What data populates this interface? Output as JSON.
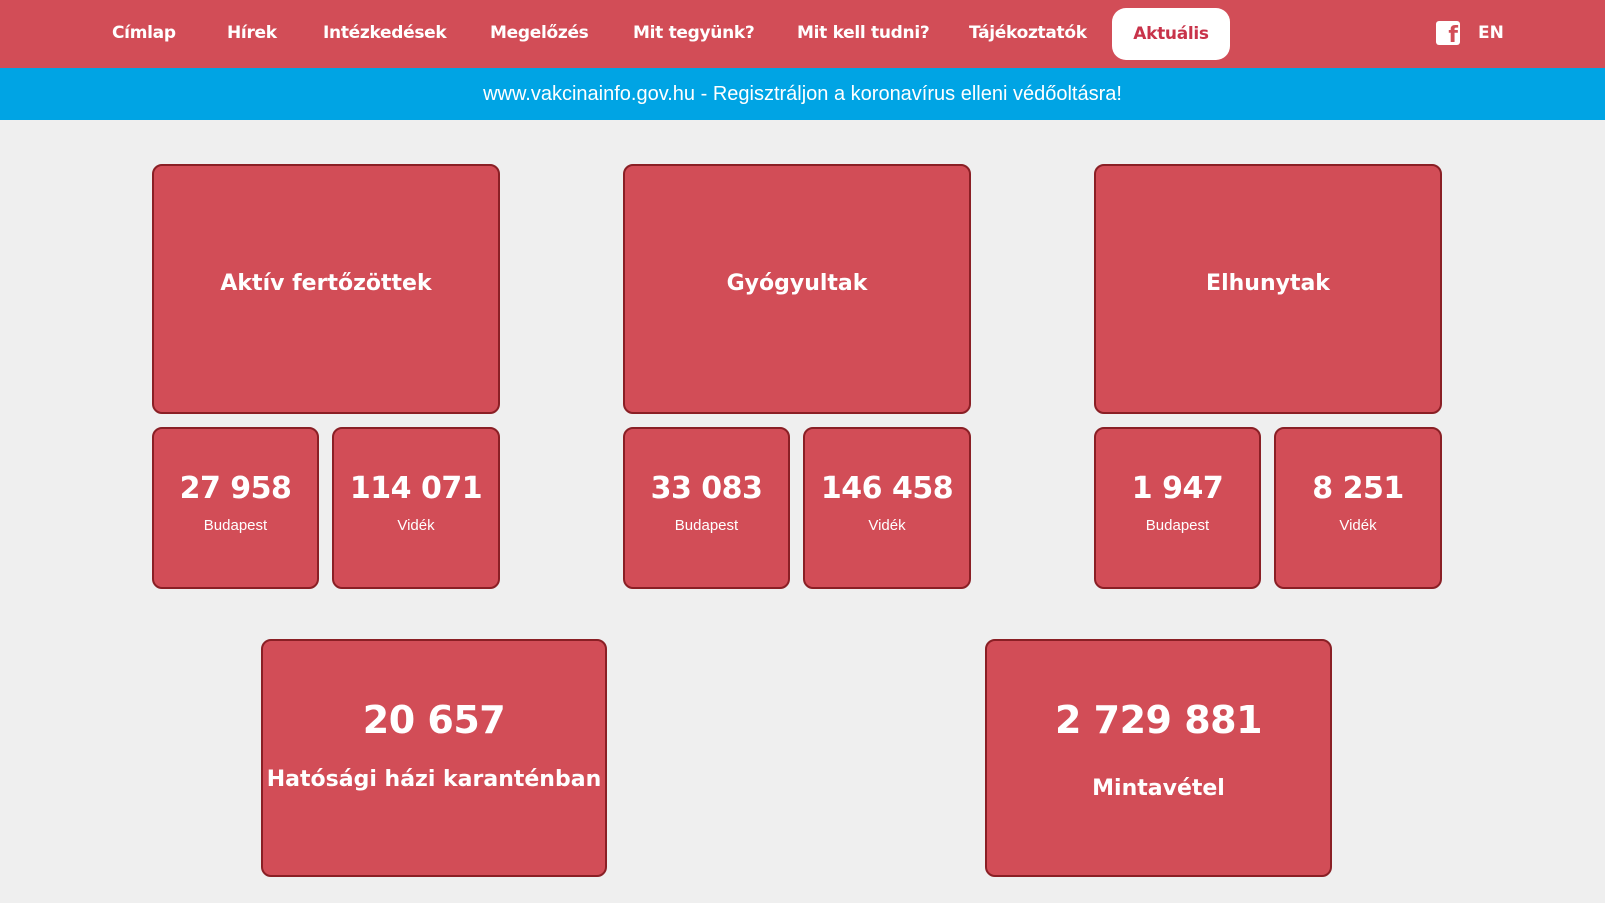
{
  "nav": {
    "items": [
      {
        "label": "Címlap"
      },
      {
        "label": "Hírek"
      },
      {
        "label": "Intézkedések"
      },
      {
        "label": "Megelőzés"
      },
      {
        "label": "Mit tegyünk?"
      },
      {
        "label": "Mit kell tudni?"
      },
      {
        "label": "Tájékoztatók"
      },
      {
        "label": "Aktuális"
      }
    ],
    "facebook_icon": "facebook-icon",
    "language": "EN"
  },
  "banner": {
    "text": "www.vakcinainfo.gov.hu - Regisztráljon a koronavírus elleni védőoltásra!"
  },
  "stats": {
    "active": {
      "title": "Aktív fertőzöttek",
      "budapest": {
        "value": "27 958",
        "label": "Budapest"
      },
      "videk": {
        "value": "114 071",
        "label": "Vidék"
      }
    },
    "recovered": {
      "title": "Gyógyultak",
      "budapest": {
        "value": "33 083",
        "label": "Budapest"
      },
      "videk": {
        "value": "146 458",
        "label": "Vidék"
      }
    },
    "deceased": {
      "title": "Elhunytak",
      "budapest": {
        "value": "1 947",
        "label": "Budapest"
      },
      "videk": {
        "value": "8 251",
        "label": "Vidék"
      }
    },
    "quarantine": {
      "value": "20 657",
      "label": "Hatósági házi karanténban"
    },
    "samples": {
      "value": "2 729 881",
      "label": "Mintavétel"
    }
  },
  "colors": {
    "primary": "#d24d57",
    "border": "#8a1f25",
    "banner": "#00a4e4",
    "background": "#efefef"
  }
}
